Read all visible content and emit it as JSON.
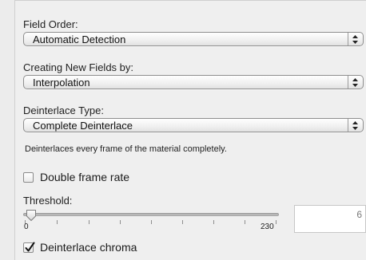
{
  "field_order": {
    "label": "Field Order:",
    "selected": "Automatic Detection"
  },
  "creating_new_fields": {
    "label": "Creating New Fields by:",
    "selected": "Interpolation"
  },
  "deinterlace_type": {
    "label": "Deinterlace Type:",
    "selected": "Complete Deinterlace",
    "description": "Deinterlaces every frame of the material completely."
  },
  "double_frame_rate": {
    "label": "Double frame rate",
    "checked": false
  },
  "threshold": {
    "label": "Threshold:",
    "min_label": "0",
    "max_label": "230",
    "min": 0,
    "max": 230,
    "value": 6,
    "value_text": "6"
  },
  "deinterlace_chroma": {
    "label": "Deinterlace chroma",
    "checked": true
  }
}
